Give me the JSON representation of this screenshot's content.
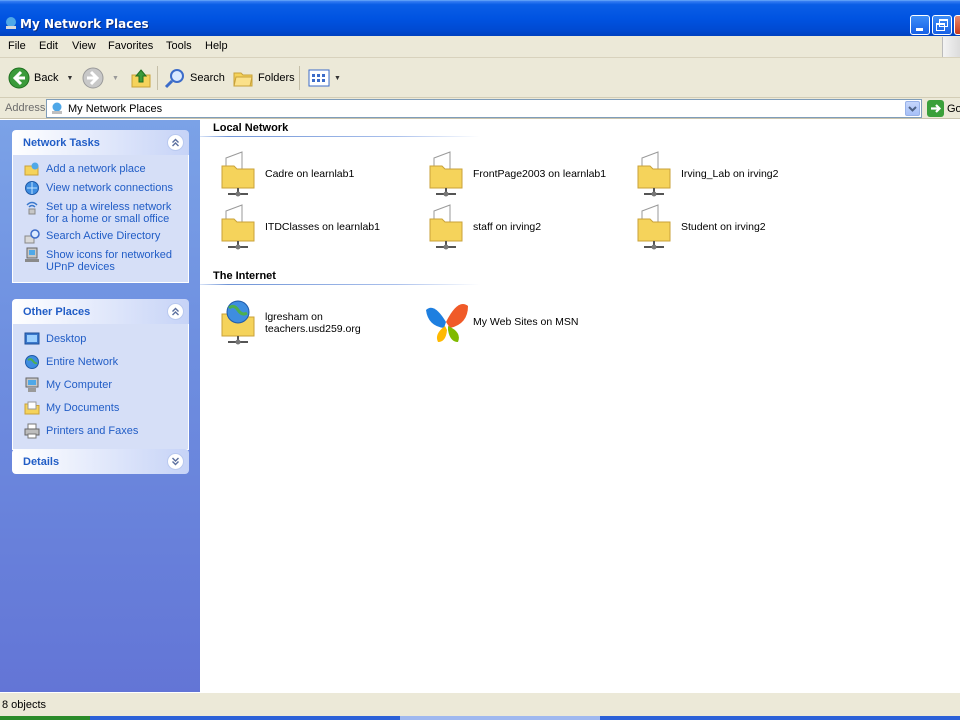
{
  "window": {
    "title": "My Network Places"
  },
  "menu": {
    "items": [
      "File",
      "Edit",
      "View",
      "Favorites",
      "Tools",
      "Help"
    ]
  },
  "toolbar": {
    "back_label": "Back",
    "search_label": "Search",
    "folders_label": "Folders"
  },
  "address": {
    "label": "Address",
    "value": "My Network Places",
    "go_label": "Go"
  },
  "sidebar": {
    "network_tasks": {
      "title": "Network Tasks",
      "items": [
        {
          "label": "Add a network place",
          "icon": "add-network-place-icon"
        },
        {
          "label": "View network connections",
          "icon": "network-connections-icon"
        },
        {
          "label": "Set up a wireless network\nfor a home or small office",
          "icon": "wireless-network-icon"
        },
        {
          "label": "Search Active Directory",
          "icon": "search-directory-icon"
        },
        {
          "label": "Show icons for networked\nUPnP devices",
          "icon": "upnp-devices-icon"
        }
      ]
    },
    "other_places": {
      "title": "Other Places",
      "items": [
        {
          "label": "Desktop",
          "icon": "desktop-icon"
        },
        {
          "label": "Entire Network",
          "icon": "globe-icon"
        },
        {
          "label": "My Computer",
          "icon": "computer-icon"
        },
        {
          "label": "My Documents",
          "icon": "folder-icon"
        },
        {
          "label": "Printers and Faxes",
          "icon": "printer-icon"
        }
      ]
    },
    "details": {
      "title": "Details"
    }
  },
  "content": {
    "local_network": {
      "header": "Local Network",
      "items": [
        {
          "label": "Cadre on learnlab1"
        },
        {
          "label": "FrontPage2003 on learnlab1"
        },
        {
          "label": "Irving_Lab on irving2"
        },
        {
          "label": "ITDClasses on learnlab1"
        },
        {
          "label": "staff on irving2"
        },
        {
          "label": "Student on irving2"
        }
      ]
    },
    "internet": {
      "header": "The Internet",
      "items": [
        {
          "label": "lgresham on\nteachers.usd259.org",
          "icon": "web-folder-icon"
        },
        {
          "label": "My Web Sites on MSN",
          "icon": "msn-butterfly-icon"
        }
      ]
    }
  },
  "status": {
    "text": "8 objects"
  }
}
